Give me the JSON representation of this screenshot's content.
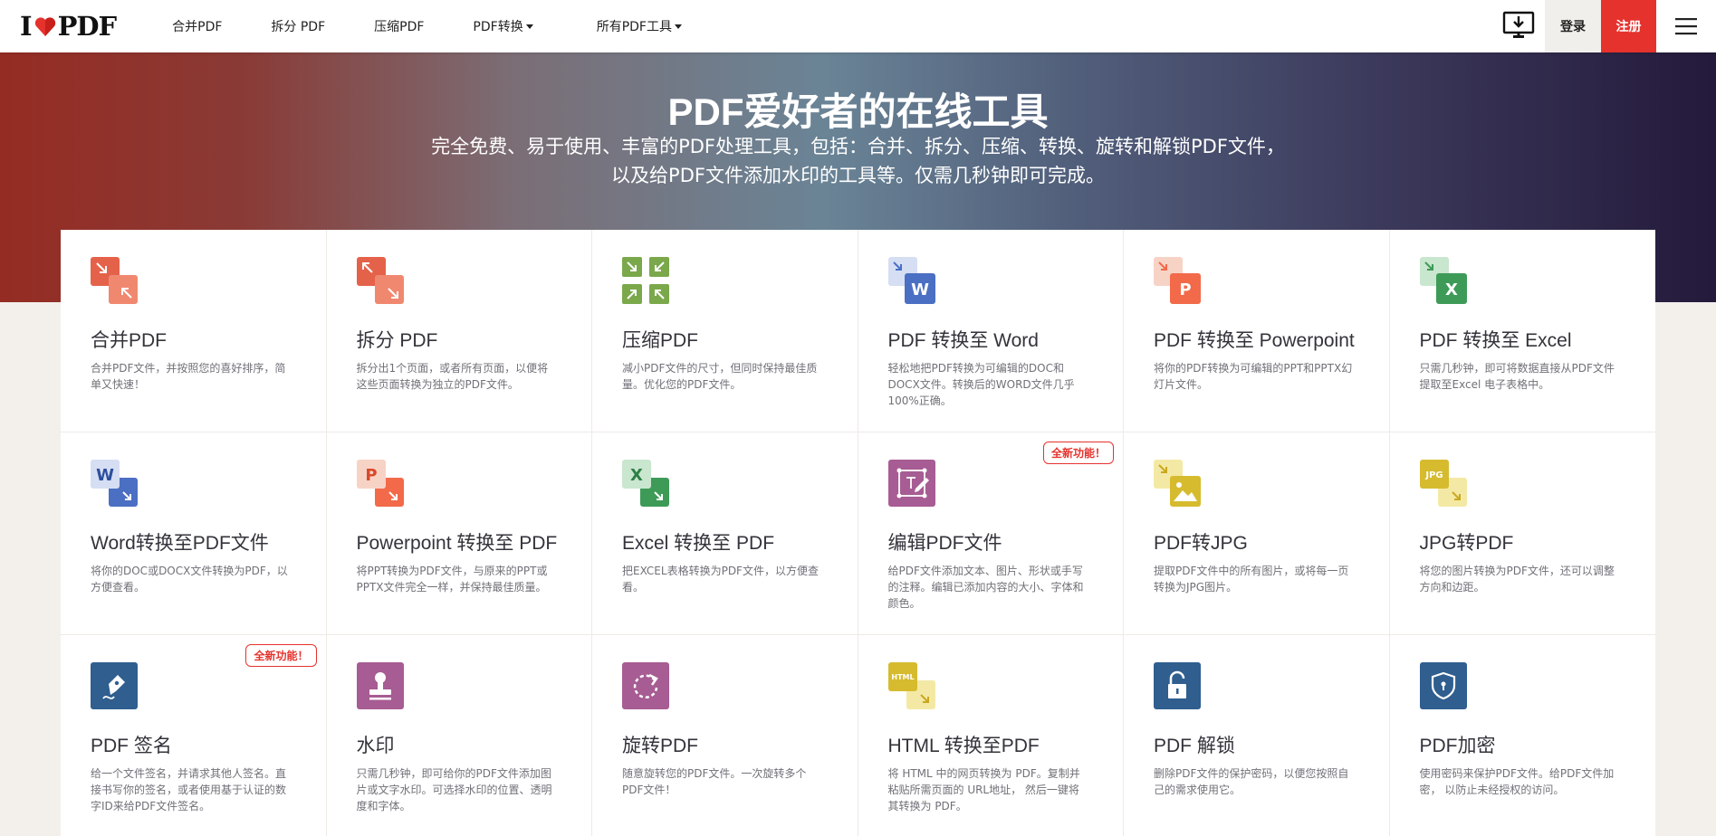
{
  "header": {
    "logo_text": "PDF",
    "logo_prefix": "I",
    "nav": [
      {
        "label": "合并PDF",
        "dropdown": false
      },
      {
        "label": "拆分 PDF",
        "dropdown": false
      },
      {
        "label": "压缩PDF",
        "dropdown": false
      },
      {
        "label": "PDF转换",
        "dropdown": true
      },
      {
        "label": "所有PDF工具",
        "dropdown": true
      }
    ],
    "login_label": "登录",
    "signup_label": "注册",
    "icons": [
      "desktop-download-icon",
      "hamburger-menu-icon"
    ]
  },
  "hero": {
    "title": "PDF爱好者的在线工具",
    "subtitle": "完全免费、易于使用、丰富的PDF处理工具，包括：合并、拆分、压缩、转换、旋转和解锁PDF文件，以及给PDF文件添加水印的工具等。仅需几秒钟即可完成。"
  },
  "tools": [
    {
      "title": "合并PDF",
      "desc": "合并PDF文件，并按照您的喜好排序，简单又快速！",
      "icon": "merge-pdf-icon"
    },
    {
      "title": "拆分 PDF",
      "desc": "拆分出1个页面，或者所有页面，以便将这些页面转换为独立的PDF文件。",
      "icon": "split-pdf-icon"
    },
    {
      "title": "压缩PDF",
      "desc": "减小PDF文件的尺寸，但同时保持最佳质量。优化您的PDF文件。",
      "icon": "compress-pdf-icon"
    },
    {
      "title": "PDF 转换至 Word",
      "desc": "轻松地把PDF转换为可编辑的DOC和DOCX文件。转换后的WORD文件几乎100%正确。",
      "icon": "pdf-to-word-icon"
    },
    {
      "title": "PDF 转换至 Powerpoint",
      "desc": "将你的PDF转换为可编辑的PPT和PPTX幻灯片文件。",
      "icon": "pdf-to-powerpoint-icon"
    },
    {
      "title": "PDF 转换至 Excel",
      "desc": "只需几秒钟，即可将数据直接从PDF文件提取至Excel 电子表格中。",
      "icon": "pdf-to-excel-icon"
    },
    {
      "title": "Word转换至PDF文件",
      "desc": "将你的DOC或DOCX文件转换为PDF，以方便查看。",
      "icon": "word-to-pdf-icon"
    },
    {
      "title": "Powerpoint 转换至 PDF",
      "desc": "将PPT转换为PDF文件，与原来的PPT或PPTX文件完全一样，并保持最佳质量。",
      "icon": "powerpoint-to-pdf-icon"
    },
    {
      "title": "Excel 转换至 PDF",
      "desc": "把EXCEL表格转换为PDF文件，以方便查看。",
      "icon": "excel-to-pdf-icon"
    },
    {
      "title": "编辑PDF文件",
      "desc": "给PDF文件添加文本、图片、形状或手写的注释。编辑已添加内容的大小、字体和颜色。",
      "icon": "edit-pdf-icon",
      "badge": "全新功能！"
    },
    {
      "title": "PDF转JPG",
      "desc": "提取PDF文件中的所有图片，或将每一页转换为JPG图片。",
      "icon": "pdf-to-jpg-icon"
    },
    {
      "title": "JPG转PDF",
      "desc": "将您的图片转换为PDF文件，还可以调整方向和边距。",
      "icon": "jpg-to-pdf-icon"
    },
    {
      "title": "PDF 签名",
      "desc": "给一个文件签名，并请求其他人签名。直接书写你的签名，或者使用基于认证的数字ID来给PDF文件签名。",
      "icon": "sign-pdf-icon",
      "badge": "全新功能！"
    },
    {
      "title": "水印",
      "desc": "只需几秒钟，即可给你的PDF文件添加图片或文字水印。可选择水印的位置、透明度和字体。",
      "icon": "watermark-icon"
    },
    {
      "title": "旋转PDF",
      "desc": "随意旋转您的PDF文件。一次旋转多个PDF文件！",
      "icon": "rotate-pdf-icon"
    },
    {
      "title": "HTML 转换至PDF",
      "desc": "将 HTML 中的网页转换为 PDF。复制并粘贴所需页面的 URL地址， 然后一键将其转换为 PDF。",
      "icon": "html-to-pdf-icon"
    },
    {
      "title": "PDF 解锁",
      "desc": "删除PDF文件的保护密码，以便您按照自己的需求使用它。",
      "icon": "unlock-pdf-icon"
    },
    {
      "title": "PDF加密",
      "desc": "使用密码来保护PDF文件。给PDF文件加密， 以防止未经授权的访问。",
      "icon": "protect-pdf-icon"
    }
  ],
  "icon_labels": {
    "word": "W",
    "ppt": "P",
    "excel": "X",
    "jpg": "JPG",
    "html": "HTML"
  },
  "colors": {
    "brand_red": "#e5322d",
    "merge": "#e5624a",
    "compress": "#7aa84b",
    "word": "#4b6fc3",
    "ppt": "#f26a4a",
    "excel": "#3e9b57",
    "edit": "#a75c93",
    "jpg": "#d6bb2f",
    "sign": "#2f5e8f",
    "watermark": "#a75c93",
    "html": "#d6bb2f",
    "lock": "#2f5e8f"
  }
}
